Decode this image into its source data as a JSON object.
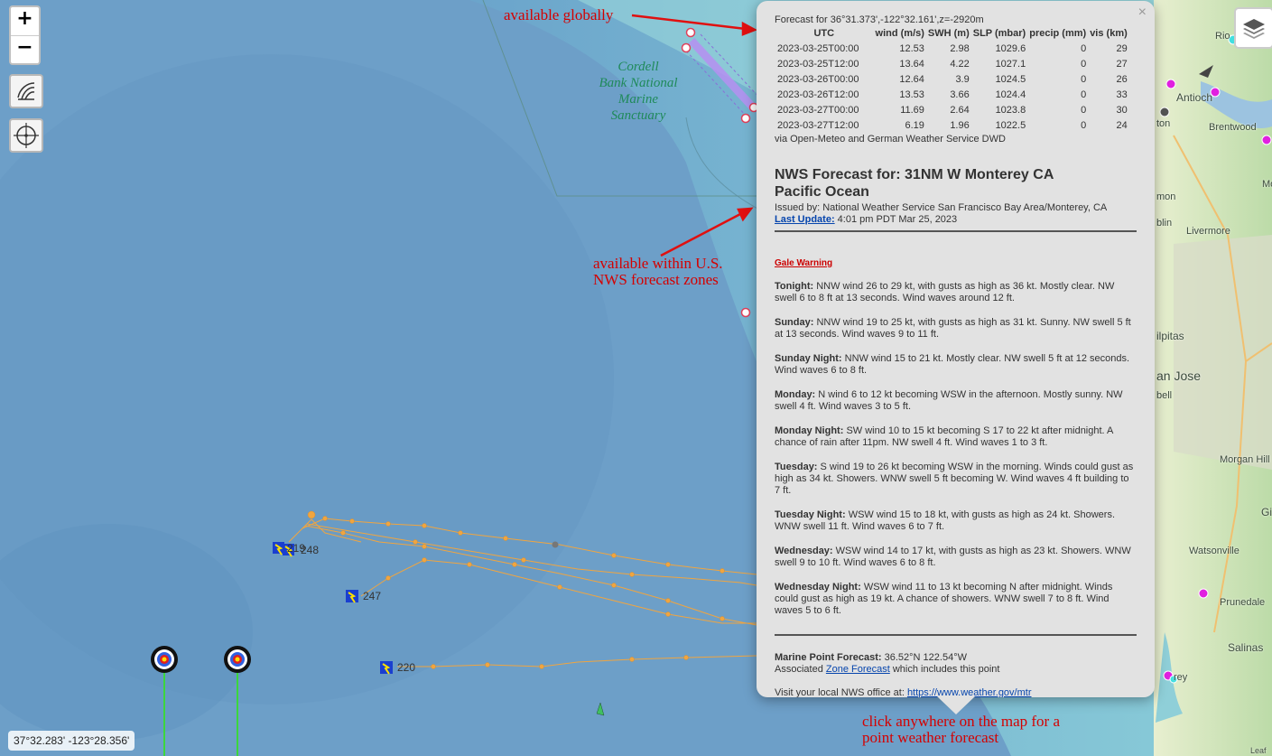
{
  "controls": {
    "zoom_in": "+",
    "zoom_out": "−",
    "coordinates": "37°32.283' -123°28.356'",
    "icons": [
      "plus-icon",
      "minus-icon",
      "nautical-chart-icon",
      "crosshair-icon",
      "layers-icon"
    ]
  },
  "annotations": {
    "global": "available globally",
    "nws": [
      "available within U.S.",
      "NWS forecast zones"
    ],
    "click": [
      "click anywhere on the map for a",
      "point weather forecast"
    ]
  },
  "map_labels": {
    "sanctuary": [
      "Cordell",
      "Bank National",
      "Marine",
      "Sanctuary"
    ],
    "tracks": [
      "219",
      "248",
      "247",
      "220"
    ],
    "cities": [
      "Rio",
      "Antioch",
      "ton",
      "Brentwood",
      "mon",
      "blin",
      "Livermore",
      "ilpitas",
      "an Jose",
      "bell",
      "Morgan Hill",
      "Gi",
      "Watsonville",
      "Prunedale",
      "Salinas",
      "rey",
      "Mo",
      "Leaf"
    ]
  },
  "popup": {
    "header": "Forecast for 36°31.373',-122°32.161',z=-2920m",
    "columns": [
      "UTC",
      "wind (m/s)",
      "SWH (m)",
      "SLP (mbar)",
      "precip (mm)",
      "vis (km)"
    ],
    "rows": [
      [
        "2023-03-25T00:00",
        "12.53",
        "2.98",
        "1029.6",
        "0",
        "29"
      ],
      [
        "2023-03-25T12:00",
        "13.64",
        "4.22",
        "1027.1",
        "0",
        "27"
      ],
      [
        "2023-03-26T00:00",
        "12.64",
        "3.9",
        "1024.5",
        "0",
        "26"
      ],
      [
        "2023-03-26T12:00",
        "13.53",
        "3.66",
        "1024.4",
        "0",
        "33"
      ],
      [
        "2023-03-27T00:00",
        "11.69",
        "2.64",
        "1023.8",
        "0",
        "30"
      ],
      [
        "2023-03-27T12:00",
        "6.19",
        "1.96",
        "1022.5",
        "0",
        "24"
      ]
    ],
    "source": "via Open-Meteo and German Weather Service DWD",
    "nws_title_1": "NWS Forecast for: 31NM W Monterey CA",
    "nws_title_2": "Pacific Ocean",
    "issued": "Issued by: National Weather Service San Francisco Bay Area/Monterey, CA",
    "last_update_label": "Last Update:",
    "last_update_value": " 4:01 pm PDT Mar 25, 2023",
    "warning": "Gale Warning",
    "periods": [
      {
        "name": "Tonight:",
        "text": " NNW wind 26 to 29 kt, with gusts as high as 36 kt. Mostly clear. NW swell 6 to 8 ft at 13 seconds. Wind waves around 12 ft."
      },
      {
        "name": "Sunday:",
        "text": " NNW wind 19 to 25 kt, with gusts as high as 31 kt. Sunny. NW swell 5 ft at 13 seconds. Wind waves 9 to 11 ft."
      },
      {
        "name": "Sunday Night:",
        "text": " NNW wind 15 to 21 kt. Mostly clear. NW swell 5 ft at 12 seconds. Wind waves 6 to 8 ft."
      },
      {
        "name": "Monday:",
        "text": " N wind 6 to 12 kt becoming WSW in the afternoon. Mostly sunny. NW swell 4 ft. Wind waves 3 to 5 ft."
      },
      {
        "name": "Monday Night:",
        "text": " SW wind 10 to 15 kt becoming S 17 to 22 kt after midnight. A chance of rain after 11pm. NW swell 4 ft. Wind waves 1 to 3 ft."
      },
      {
        "name": "Tuesday:",
        "text": " S wind 19 to 26 kt becoming WSW in the morning. Winds could gust as high as 34 kt. Showers. WNW swell 5 ft becoming W. Wind waves 4 ft building to 7 ft."
      },
      {
        "name": "Tuesday Night:",
        "text": " WSW wind 15 to 18 kt, with gusts as high as 24 kt. Showers. WNW swell 11 ft. Wind waves 6 to 7 ft."
      },
      {
        "name": "Wednesday:",
        "text": " WSW wind 14 to 17 kt, with gusts as high as 23 kt. Showers. WNW swell 9 to 10 ft. Wind waves 6 to 8 ft."
      },
      {
        "name": "Wednesday Night:",
        "text": " WSW wind 11 to 13 kt becoming N after midnight. Winds could gust as high as 19 kt. A chance of showers. WNW swell 7 to 8 ft. Wind waves 5 to 6 ft."
      }
    ],
    "marine_label": "Marine Point Forecast:",
    "marine_value": " 36.52°N 122.54°W",
    "assoc_pre": "Associated ",
    "assoc_link": "Zone Forecast",
    "assoc_post": " which includes this point",
    "visit_pre": "Visit your local NWS office at: ",
    "visit_link": "https://www.weather.gov/mtr",
    "close": "×"
  },
  "colors": {
    "ocean": "#6fa0c8",
    "annotation": "#d40000",
    "track": "#f0a030",
    "route": "#b07cf0",
    "land": "#cfe3b8"
  }
}
